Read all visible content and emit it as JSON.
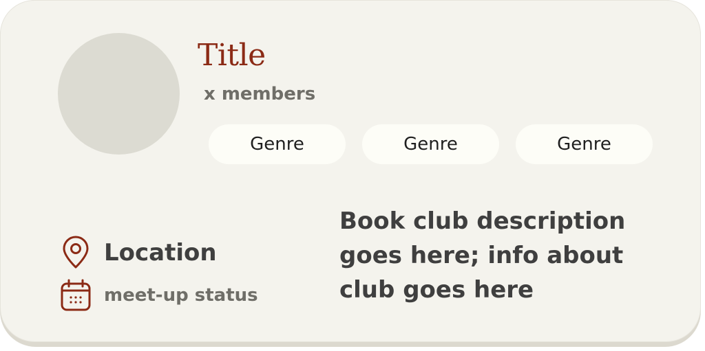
{
  "club": {
    "title": "Title",
    "members": "x members",
    "genres": [
      "Genre",
      "Genre",
      "Genre"
    ],
    "location": "Location",
    "meetup_status": "meet-up status",
    "description": "Book club description goes here; info about club goes here"
  },
  "icons": {
    "location": "map-pin-icon",
    "status": "calendar-icon"
  },
  "colors": {
    "card_background": "#f4f3ed",
    "accent": "#8b2a15",
    "chip_background": "#fdfdf7",
    "avatar_placeholder": "#dcdbd2"
  }
}
